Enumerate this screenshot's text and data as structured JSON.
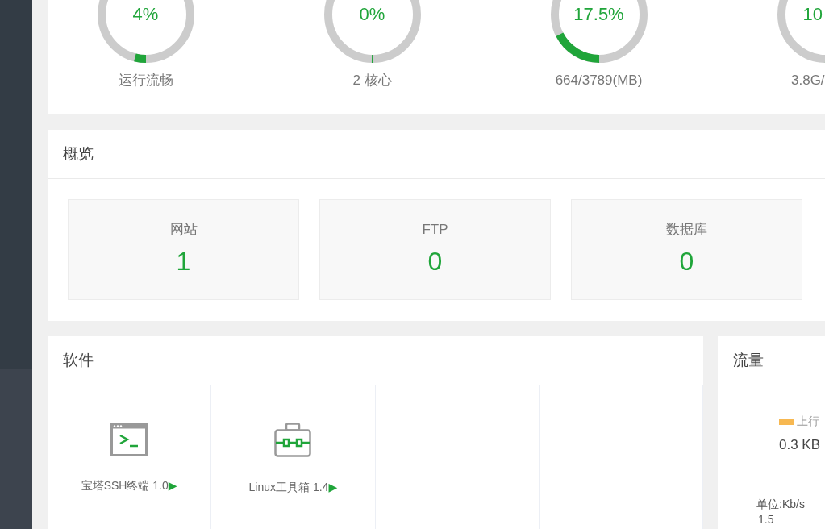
{
  "gauges": [
    {
      "value": "4%",
      "level": 0.04,
      "label": "运行流畅"
    },
    {
      "value": "0%",
      "level": 0,
      "label": "2 核心"
    },
    {
      "value": "17.5%",
      "level": 0.175,
      "label": "664/3789(MB)"
    },
    {
      "value": "10",
      "level": 0,
      "label": "3.8G/"
    }
  ],
  "overview": {
    "title": "概览",
    "stats": [
      {
        "label": "网站",
        "value": "1"
      },
      {
        "label": "FTP",
        "value": "0"
      },
      {
        "label": "数据库",
        "value": "0"
      }
    ]
  },
  "software": {
    "title": "软件",
    "items": [
      {
        "kind": "terminal",
        "name": "宝塔SSH终端 1.0",
        "arrow": "▶"
      },
      {
        "kind": "toolbox",
        "name": "Linux工具箱 1.4",
        "arrow": "▶"
      },
      {
        "kind": "empty"
      },
      {
        "kind": "empty"
      }
    ]
  },
  "traffic": {
    "title": "流量",
    "legend": {
      "label": "上行",
      "color": "#f7b851"
    },
    "value": "0.3 KB",
    "unit": "单位:Kb/s",
    "y_tick": "1.5"
  }
}
